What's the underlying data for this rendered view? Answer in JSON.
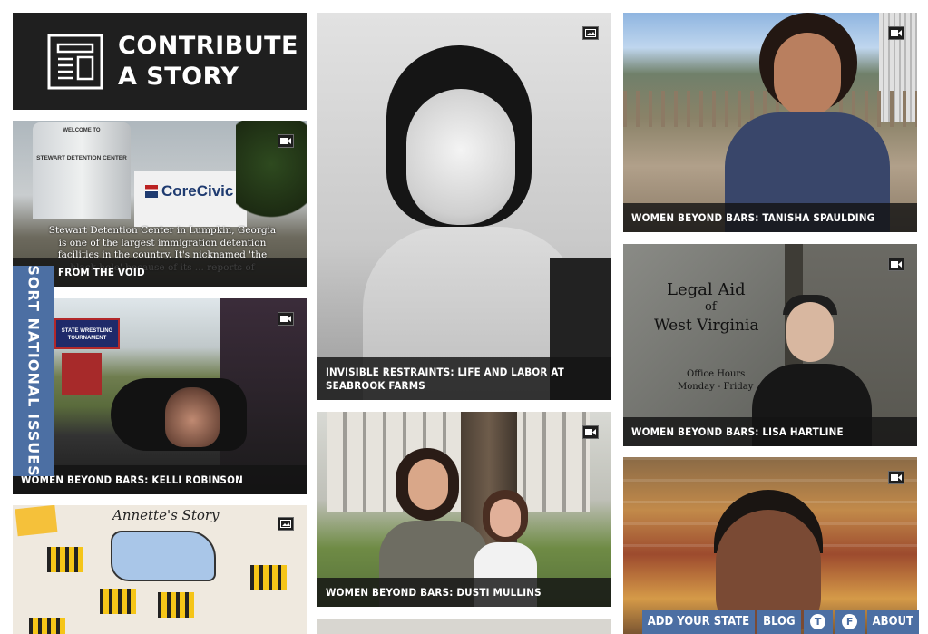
{
  "contribute": {
    "line1": "CONTRIBUTE",
    "line2": "A STORY"
  },
  "sort_tab": {
    "label": "SORT NATIONAL ISSUES"
  },
  "tiles": {
    "stewart": {
      "caption": "FROM THE VOID",
      "overlay": "Stewart Detention Center in Lumpkin, Georgia is one of the largest immigration detention facilities in the country. It's nicknamed 'the black hole' because of its ... reports of inadequate conditions.",
      "sign_welcome": "WELCOME TO",
      "sign_name": "STEWART DETENTION CENTER",
      "sign_corecivic": "CoreCivic",
      "media_icon": "video-icon"
    },
    "kelli": {
      "caption": "WOMEN BEYOND BARS: KELLI ROBINSON",
      "sign_text": "STATE WRESTLING TOURNAMENT",
      "media_icon": "video-icon"
    },
    "annette": {
      "title": "Annette's Story",
      "media_icon": "image-icon"
    },
    "seabrook": {
      "caption": "INVISIBLE RESTRAINTS: LIFE AND LABOR AT SEABROOK FARMS",
      "media_icon": "image-icon"
    },
    "dusti": {
      "caption": "WOMEN BEYOND BARS: DUSTI MULLINS",
      "media_icon": "video-icon"
    },
    "tanisha": {
      "caption": "WOMEN BEYOND BARS: TANISHA SPAULDING",
      "media_icon": "video-icon"
    },
    "lisa": {
      "caption": "WOMEN BEYOND BARS: LISA HARTLINE",
      "door_line1": "Legal Aid",
      "door_line2": "of",
      "door_line3": "West Virginia",
      "door_hours": "Office Hours",
      "door_days": "Monday - Friday",
      "media_icon": "video-icon"
    },
    "bottom_right": {
      "media_icon": "video-icon"
    }
  },
  "bottom_nav": {
    "add_state": "ADD YOUR STATE",
    "blog": "BLOG",
    "twitter_icon": "twitter-icon",
    "facebook_icon": "facebook-icon",
    "about": "ABOUT"
  },
  "colors": {
    "accent_blue": "#4c6fa3",
    "dark_panel": "#1f1f1f"
  }
}
